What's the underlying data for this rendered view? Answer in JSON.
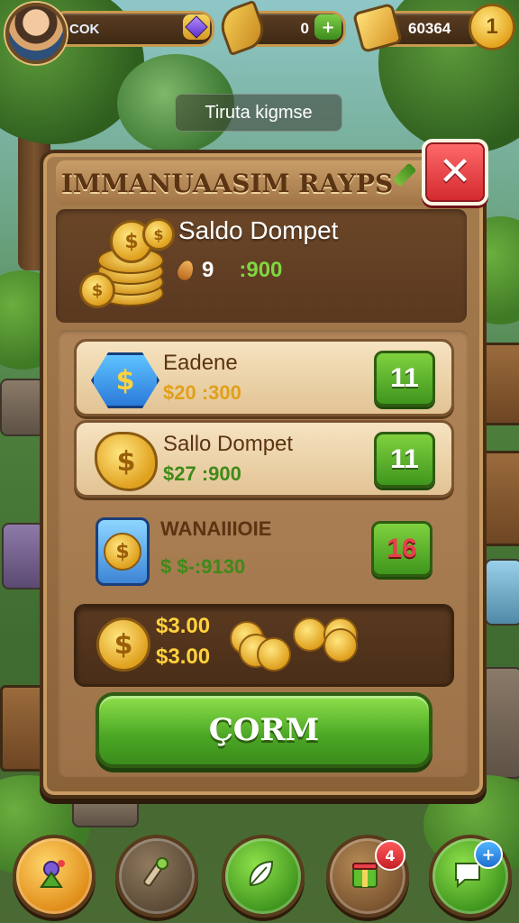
{
  "topbar": {
    "player_name": "COK",
    "leaf_count": "0",
    "plus_symbol": "+",
    "gold_amount": "60364",
    "coin_level": "1"
  },
  "tooltip": {
    "label": "Tiruta kigmse"
  },
  "panel": {
    "title": "IMMANUAASIM RAYPS",
    "close_symbol": "✕",
    "balance": {
      "title": "Saldo Dompet",
      "count": "9",
      "amount": ":900"
    },
    "items": [
      {
        "title": "Eadene",
        "price": "$20 :300",
        "button": "11",
        "icon": "blue-hex-coin-icon"
      },
      {
        "title": "Sallo Dompet",
        "price": "$27 :900",
        "button": "11",
        "icon": "gold-badge-coin-icon"
      },
      {
        "title": "WANAIIIOIE",
        "price": "$ $-:9130",
        "button": "16",
        "icon": "coin-card-icon"
      }
    ],
    "summary": {
      "line1": "$3.00",
      "line2": "$3.00"
    },
    "confirm_label": "ÇORM",
    "coin_symbol": "$"
  },
  "bottom_nav": [
    {
      "name": "flower-icon"
    },
    {
      "name": "wrench-icon"
    },
    {
      "name": "leaf-icon"
    },
    {
      "name": "gift-box-icon",
      "badge": "4"
    },
    {
      "name": "chat-icon",
      "badge": "+"
    }
  ],
  "colors": {
    "accent_green": "#4aa624",
    "panel_brown": "#8a6238",
    "close_red": "#d3282e",
    "gold": "#e0a11f"
  }
}
